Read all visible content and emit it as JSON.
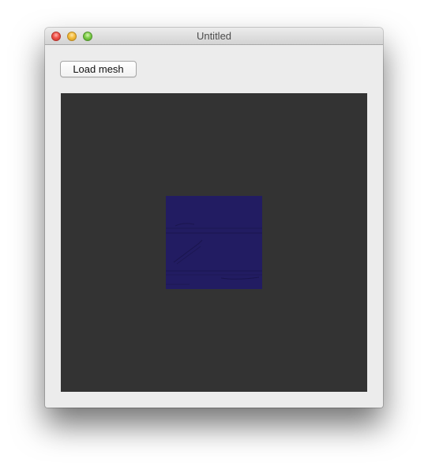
{
  "window": {
    "title": "Untitled"
  },
  "toolbar": {
    "load_mesh_label": "Load mesh"
  },
  "viewport": {
    "background_color": "#333333",
    "mesh_color": "#221c62"
  },
  "icons": {
    "close": "close-button-red-circle",
    "minimize": "minimize-button-yellow-circle",
    "zoom": "zoom-button-green-circle"
  }
}
